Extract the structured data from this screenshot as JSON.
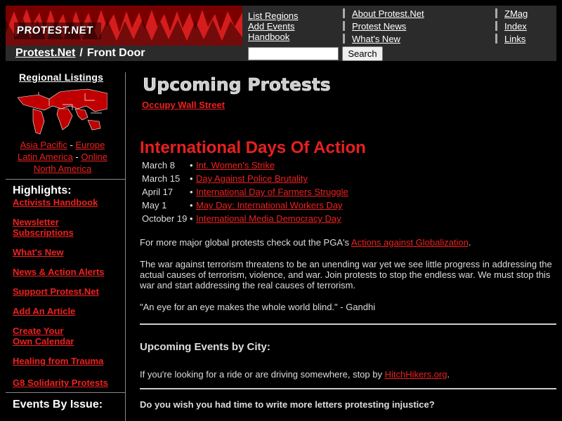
{
  "header": {
    "logo_text": "PROTEST.NET",
    "breadcrumb": {
      "home": "Protest.Net",
      "separator": "/",
      "current": "Front Door"
    },
    "nav_col1": [
      "List Regions",
      "Add Events",
      "Handbook"
    ],
    "nav_col2": [
      "About Protest.Net",
      "Protest News",
      "What's New"
    ],
    "nav_col3": [
      "ZMag",
      "Index",
      "Links"
    ],
    "search": {
      "value": "",
      "button_label": "Search"
    }
  },
  "sidebar": {
    "regional_title": "Regional Listings",
    "regions": {
      "asia_pacific": "Asia Pacific",
      "sep1": "-",
      "europe": "Europe",
      "latin_america": "Latin America",
      "sep2": "-",
      "online": "Online",
      "north_america": "North America"
    },
    "highlights_title": "Highlights:",
    "highlights": [
      "Activists Handbook",
      "Newsletter Subscriptions",
      "What's New",
      "News & Action Alerts",
      "Support Protest.Net",
      "Add An Article",
      "Create Your Own Calendar",
      "Healing from Trauma",
      "G8 Solidarity Protests"
    ],
    "events_by_issue_title": "Events By Issue:"
  },
  "main": {
    "upcoming_title": "Upcoming Protests",
    "featured_link": "Occupy Wall Street",
    "days_title": "International Days Of Action",
    "days": [
      {
        "date": "March 8",
        "label": "Int. Women's Strike"
      },
      {
        "date": "March 15",
        "label": "Day Against Police Brutality"
      },
      {
        "date": "April 17",
        "label": "International Day of Farmers Struggle"
      },
      {
        "date": "May 1",
        "label": "May Day: International Workers Day"
      },
      {
        "date": "October 19",
        "label": "International Media Democracy Day"
      }
    ],
    "bullet": "•",
    "pga_prefix": "For more major global protests check out the PGA's ",
    "pga_link": "Actions against Globalization",
    "pga_suffix": ".",
    "terror_paragraph": "The war against terrorism threatens to be an unending war yet we see little progress in addressing the actual causes of terrorism, violence, and war. Join protests to stop the endless war. We must stop this war and start addressing the real causes of terrorism.",
    "quote": "\"An eye for an eye makes the whole world blind.\" - Gandhi",
    "events_city_title": "Upcoming Events by City:",
    "hitch_prefix": "If you're looking for a ride or are driving somewhere, stop by ",
    "hitch_link": "HitchHikers.org",
    "hitch_suffix": ".",
    "letters_line": "Do you wish you had time to write more letters protesting injustice?"
  },
  "colors": {
    "accent": "#f02020",
    "background": "#000000",
    "header_bg": "#2b2b2b",
    "logo_bg": "#8a0000"
  }
}
